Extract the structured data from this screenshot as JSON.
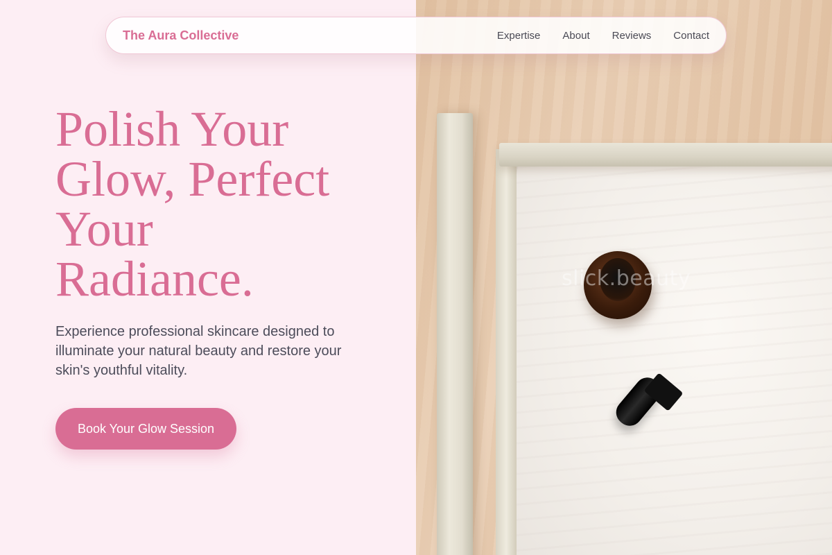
{
  "nav": {
    "brand": "The Aura Collective",
    "links": [
      "Expertise",
      "About",
      "Reviews",
      "Contact"
    ]
  },
  "hero": {
    "title_lines": [
      "Polish Your",
      "Glow, Perfect",
      "Your",
      "Radiance."
    ],
    "subtitle": "Experience professional skincare designed to illuminate your natural beauty and restore your skin's youthful vitality.",
    "cta_label": "Book Your Glow Session"
  },
  "image": {
    "watermark": "slick.beauty"
  },
  "colors": {
    "accent": "#d96d94",
    "background": "#fdeef4",
    "body_text": "#4c4c5a"
  }
}
